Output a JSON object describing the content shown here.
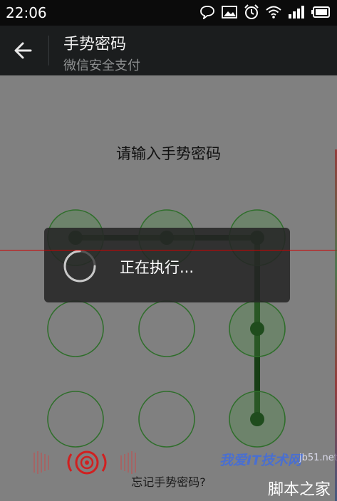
{
  "status_bar": {
    "time": "22:06",
    "icons": [
      "chat-bubble-icon",
      "image-icon",
      "alarm-clock-icon",
      "wifi-icon",
      "signal-icon",
      "battery-icon"
    ]
  },
  "app_bar": {
    "title": "手势密码",
    "subtitle": "微信安全支付",
    "back_icon": "arrow-back-icon"
  },
  "prompt": "请输入手势密码",
  "pattern": {
    "grid": 3,
    "selected_sequence": [
      1,
      2,
      3,
      6,
      9
    ],
    "colors": {
      "ring": "#2f6e2b",
      "dot": "#1f4c1d",
      "line": "#173d15",
      "selected_fill": "#4a8a45"
    }
  },
  "loading_dialog": {
    "message": "正在执行..."
  },
  "forgot_link": "忘记手势密码?",
  "watermarks": {
    "site": "我爱IT技术网",
    "domain": "jb51.net",
    "brand": "脚本之家"
  },
  "colors": {
    "overlay": "#808080",
    "status_bar": "#0b0b0b",
    "app_bar": "#1b1d1e",
    "dialog": "#262626",
    "accent_red": "#d00000"
  }
}
